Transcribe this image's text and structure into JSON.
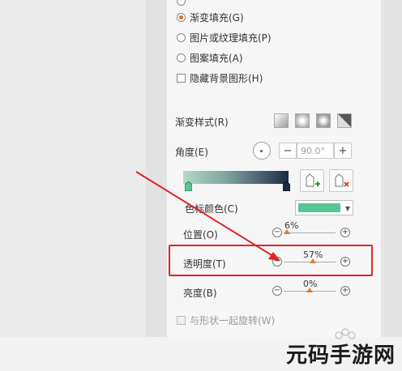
{
  "fill_options": [
    {
      "label": "渐变填充(G)",
      "selected": true
    },
    {
      "label": "图片或纹理填充(P)",
      "selected": false
    },
    {
      "label": "图案填充(A)",
      "selected": false
    }
  ],
  "hide_background": {
    "label": "隐藏背景图形(H)"
  },
  "gradient": {
    "style_label": "渐变样式(R)",
    "angle_label": "角度(E)",
    "angle_value": "90.0°",
    "angle_minus": "−",
    "angle_plus": "+",
    "color_label": "色标颜色(C)",
    "color_hex": "#57c496",
    "stop_colors": [
      "#57c496",
      "#1c2b3e"
    ]
  },
  "sliders": {
    "position": {
      "label": "位置(O)",
      "value": "6%",
      "fraction": 0.06
    },
    "transparency": {
      "label": "透明度(T)",
      "value": "57%",
      "fraction": 0.57
    },
    "brightness": {
      "label": "亮度(B)",
      "value": "0%",
      "fraction": 0.5
    }
  },
  "rotate_with_shape": {
    "label": "与形状一起旋转(W)"
  },
  "annotation": {
    "color": "#e02424"
  },
  "watermark": {
    "text": "元码手游网"
  }
}
